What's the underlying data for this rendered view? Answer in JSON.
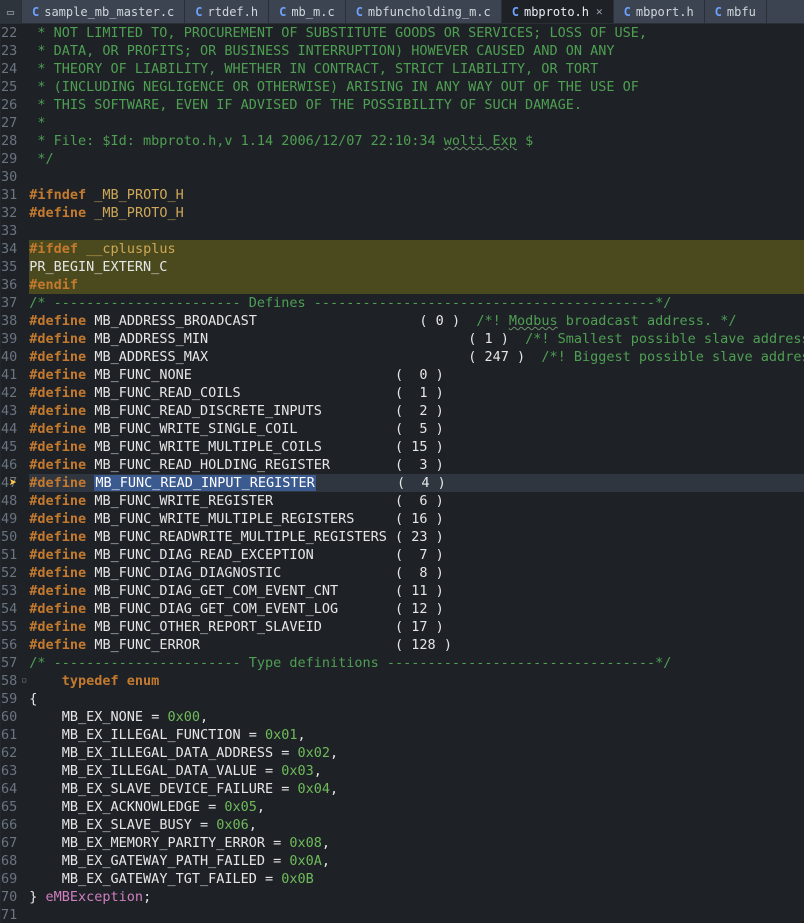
{
  "tabs": [
    {
      "label": "sample_mb_master.c",
      "icon": "C",
      "active": false
    },
    {
      "label": "rtdef.h",
      "icon": "C",
      "active": false
    },
    {
      "label": "mb_m.c",
      "icon": "C",
      "active": false
    },
    {
      "label": "mbfuncholding_m.c",
      "icon": "C",
      "active": false
    },
    {
      "label": "mbproto.h",
      "icon": "C",
      "active": true
    },
    {
      "label": "mbport.h",
      "icon": "C",
      "active": false
    },
    {
      "label": "mbfu",
      "icon": "C",
      "active": false
    }
  ],
  "active_tab_close_glyph": "✕",
  "restore_icon": "▭",
  "code_lines": [
    {
      "n": 22,
      "kind": "comment",
      "text": " * NOT LIMITED TO, PROCUREMENT OF SUBSTITUTE GOODS OR SERVICES; LOSS OF USE,"
    },
    {
      "n": 23,
      "kind": "comment",
      "text": " * DATA, OR PROFITS; OR BUSINESS INTERRUPTION) HOWEVER CAUSED AND ON ANY"
    },
    {
      "n": 24,
      "kind": "comment",
      "text": " * THEORY OF LIABILITY, WHETHER IN CONTRACT, STRICT LIABILITY, OR TORT"
    },
    {
      "n": 25,
      "kind": "comment",
      "text": " * (INCLUDING NEGLIGENCE OR OTHERWISE) ARISING IN ANY WAY OUT OF THE USE OF"
    },
    {
      "n": 26,
      "kind": "comment",
      "text": " * THIS SOFTWARE, EVEN IF ADVISED OF THE POSSIBILITY OF SUCH DAMAGE."
    },
    {
      "n": 27,
      "kind": "comment",
      "text": " *"
    },
    {
      "n": 28,
      "kind": "comment_wavy",
      "prefix": " * File: $Id: mbproto.h,v 1.14 2006/12/07 22:10:34 ",
      "wavy": "wolti Exp",
      "suffix": " $"
    },
    {
      "n": 29,
      "kind": "comment",
      "text": " */"
    },
    {
      "n": 30,
      "kind": "blank",
      "text": ""
    },
    {
      "n": 31,
      "kind": "pp",
      "kw": "#ifndef",
      "rest": " _MB_PROTO_H"
    },
    {
      "n": 32,
      "kind": "pp",
      "kw": "#define",
      "rest": " _MB_PROTO_H"
    },
    {
      "n": 33,
      "kind": "blank",
      "text": ""
    },
    {
      "n": 34,
      "kind": "pp",
      "kw": "#ifdef",
      "rest": " __cplusplus",
      "hl": true
    },
    {
      "n": 35,
      "kind": "plain",
      "text": "PR_BEGIN_EXTERN_C",
      "hl": true
    },
    {
      "n": 36,
      "kind": "pp",
      "kw": "#endif",
      "rest": "",
      "hl": true
    },
    {
      "n": 37,
      "kind": "comment",
      "text": "/* ----------------------- Defines ------------------------------------------*/"
    },
    {
      "n": 38,
      "kind": "define_c",
      "name": "MB_ADDRESS_BROADCAST",
      "val": "   ( 0 )",
      "comment_pre": "/*! ",
      "comment_wavy": "Modbus",
      "comment_post": " broadcast address. */"
    },
    {
      "n": 39,
      "kind": "define_c",
      "name": "MB_ADDRESS_MIN",
      "val": "         ( 1 )",
      "comment": "/*! Smallest possible slave address. */"
    },
    {
      "n": 40,
      "kind": "define_c",
      "name": "MB_ADDRESS_MAX",
      "val": "         ( 247 )",
      "comment": "/*! Biggest possible slave address. */"
    },
    {
      "n": 41,
      "kind": "define",
      "name": "MB_FUNC_NONE",
      "val": "(  0 )"
    },
    {
      "n": 42,
      "kind": "define",
      "name": "MB_FUNC_READ_COILS",
      "val": "(  1 )"
    },
    {
      "n": 43,
      "kind": "define",
      "name": "MB_FUNC_READ_DISCRETE_INPUTS",
      "val": "(  2 )"
    },
    {
      "n": 44,
      "kind": "define",
      "name": "MB_FUNC_WRITE_SINGLE_COIL",
      "val": "(  5 )"
    },
    {
      "n": 45,
      "kind": "define",
      "name": "MB_FUNC_WRITE_MULTIPLE_COILS",
      "val": "( 15 )"
    },
    {
      "n": 46,
      "kind": "define",
      "name": "MB_FUNC_READ_HOLDING_REGISTER",
      "val": "(  3 )"
    },
    {
      "n": 47,
      "kind": "define",
      "name": "MB_FUNC_READ_INPUT_REGISTER",
      "val": "(  4 )",
      "current": true,
      "selected": true,
      "bp": true
    },
    {
      "n": 48,
      "kind": "define",
      "name": "MB_FUNC_WRITE_REGISTER",
      "val": "(  6 )"
    },
    {
      "n": 49,
      "kind": "define",
      "name": "MB_FUNC_WRITE_MULTIPLE_REGISTERS",
      "val": "( 16 )"
    },
    {
      "n": 50,
      "kind": "define",
      "name": "MB_FUNC_READWRITE_MULTIPLE_REGISTERS",
      "val": "( 23 )"
    },
    {
      "n": 51,
      "kind": "define",
      "name": "MB_FUNC_DIAG_READ_EXCEPTION",
      "val": "(  7 )"
    },
    {
      "n": 52,
      "kind": "define",
      "name": "MB_FUNC_DIAG_DIAGNOSTIC",
      "val": "(  8 )"
    },
    {
      "n": 53,
      "kind": "define",
      "name": "MB_FUNC_DIAG_GET_COM_EVENT_CNT",
      "val": "( 11 )"
    },
    {
      "n": 54,
      "kind": "define",
      "name": "MB_FUNC_DIAG_GET_COM_EVENT_LOG",
      "val": "( 12 )"
    },
    {
      "n": 55,
      "kind": "define",
      "name": "MB_FUNC_OTHER_REPORT_SLAVEID",
      "val": "( 17 )"
    },
    {
      "n": 56,
      "kind": "define",
      "name": "MB_FUNC_ERROR",
      "val": "( 128 )"
    },
    {
      "n": 57,
      "kind": "comment",
      "text": "/* ----------------------- Type definitions ---------------------------------*/"
    },
    {
      "n": 58,
      "kind": "typedef",
      "text": "    typedef enum",
      "fold": true
    },
    {
      "n": 59,
      "kind": "plain",
      "text": "{"
    },
    {
      "n": 60,
      "kind": "enum",
      "name": "MB_EX_NONE",
      "val": "0x00",
      "comma": ","
    },
    {
      "n": 61,
      "kind": "enum",
      "name": "MB_EX_ILLEGAL_FUNCTION",
      "val": "0x01",
      "comma": ","
    },
    {
      "n": 62,
      "kind": "enum",
      "name": "MB_EX_ILLEGAL_DATA_ADDRESS",
      "val": "0x02",
      "comma": ","
    },
    {
      "n": 63,
      "kind": "enum",
      "name": "MB_EX_ILLEGAL_DATA_VALUE",
      "val": "0x03",
      "comma": ","
    },
    {
      "n": 64,
      "kind": "enum",
      "name": "MB_EX_SLAVE_DEVICE_FAILURE",
      "val": "0x04",
      "comma": ","
    },
    {
      "n": 65,
      "kind": "enum",
      "name": "MB_EX_ACKNOWLEDGE",
      "val": "0x05",
      "comma": ","
    },
    {
      "n": 66,
      "kind": "enum",
      "name": "MB_EX_SLAVE_BUSY",
      "val": "0x06",
      "comma": ","
    },
    {
      "n": 67,
      "kind": "enum",
      "name": "MB_EX_MEMORY_PARITY_ERROR",
      "val": "0x08",
      "comma": ","
    },
    {
      "n": 68,
      "kind": "enum",
      "name": "MB_EX_GATEWAY_PATH_FAILED",
      "val": "0x0A",
      "comma": ","
    },
    {
      "n": 69,
      "kind": "enum",
      "name": "MB_EX_GATEWAY_TGT_FAILED",
      "val": "0x0B",
      "comma": ""
    },
    {
      "n": 70,
      "kind": "enum_end",
      "brace": "} ",
      "typename": "eMBException",
      "semi": ";"
    },
    {
      "n": 71,
      "kind": "blank",
      "text": ""
    }
  ],
  "define_pad_to": 37
}
